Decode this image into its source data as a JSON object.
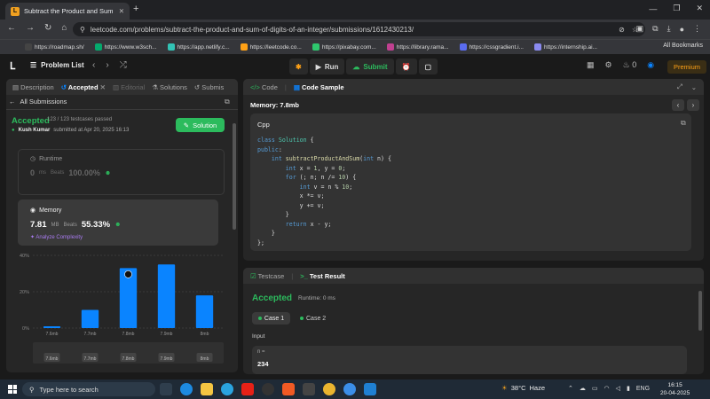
{
  "browser": {
    "tab_title": "Subtract the Product and Sum",
    "url": "leetcode.com/problems/subtract-the-product-and-sum-of-digits-of-an-integer/submissions/1612430213/",
    "bookmarks": [
      {
        "label": "https://roadmap.sh/",
        "color": "#444"
      },
      {
        "label": "https://www.w3sch...",
        "color": "#04aa6d"
      },
      {
        "label": "https://app.netlify.c...",
        "color": "#32c3b5"
      },
      {
        "label": "https://leetcode.co...",
        "color": "#ffa116"
      },
      {
        "label": "https://pixabay.com...",
        "color": "#2ec66d"
      },
      {
        "label": "https://library.rama...",
        "color": "#c04090"
      },
      {
        "label": "https://cssgradient.i...",
        "color": "#5a6cf0"
      },
      {
        "label": "https://internship.ai...",
        "color": "#8a8af0"
      }
    ],
    "all_bookmarks": "All Bookmarks"
  },
  "leetcode": {
    "problem_list": "Problem List",
    "run": "Run",
    "submit": "Submit",
    "streak": "0",
    "premium": "Premium"
  },
  "left_panel": {
    "tabs": [
      "Description",
      "Accepted",
      "Editorial",
      "Solutions",
      "Submis"
    ],
    "all_submissions": "All Submissions",
    "status": "Accepted",
    "passed": "123 / 123 testcases passed",
    "user": "Kush Kumar",
    "submitted": "submitted at Apr 20, 2025 16:13",
    "solution_btn": "Solution",
    "runtime_label": "Runtime",
    "runtime_value": "0",
    "runtime_unit": "ms",
    "runtime_beats_label": "Beats",
    "runtime_beats": "100.00%",
    "memory_label": "Memory",
    "memory_value": "7.81",
    "memory_unit": "MB",
    "memory_beats_label": "Beats",
    "memory_beats": "55.33%",
    "analyze": "Analyze Complexity"
  },
  "chart_data": {
    "type": "bar",
    "categories": [
      "7.6mb",
      "7.7mb",
      "7.8mb",
      "7.9mb",
      "8mb"
    ],
    "values": [
      1,
      10,
      33,
      35,
      18
    ],
    "ylim": [
      0,
      40
    ],
    "ytick_labels": [
      "0%",
      "20%",
      "40%"
    ],
    "highlight_index": 2,
    "bar_color": "#0a84ff",
    "lower_labels": [
      "7.6mb",
      "7.7mb",
      "7.8mb",
      "7.9mb",
      "8mb"
    ]
  },
  "code_panel": {
    "tabs": [
      "Code",
      "Code Sample"
    ],
    "memory_header": "Memory: 7.8mb",
    "language": "Cpp"
  },
  "test_panel": {
    "tabs": [
      "Testcase",
      "Test Result"
    ],
    "status": "Accepted",
    "runtime": "Runtime: 0 ms",
    "case1": "Case 1",
    "case2": "Case 2",
    "input_label": "Input",
    "var_name": "n =",
    "var_value": "234"
  },
  "taskbar": {
    "search_placeholder": "Type here to search",
    "temperature": "38°C",
    "weather": "Haze",
    "lang": "ENG",
    "time": "16:15",
    "date": "20-04-2025"
  }
}
